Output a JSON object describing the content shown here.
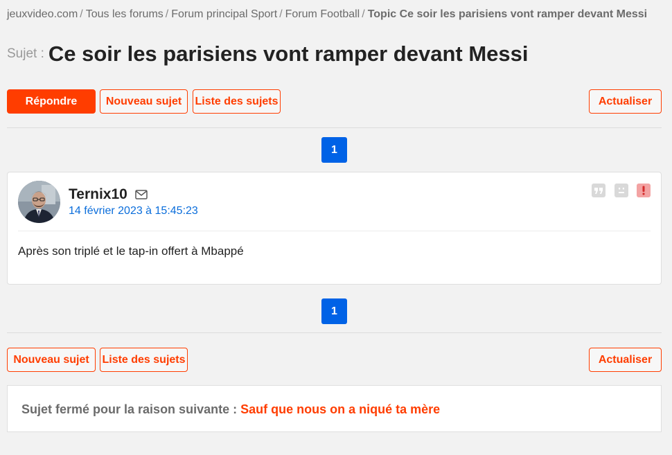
{
  "breadcrumb": {
    "items": [
      "jeuxvideo.com",
      "Tous les forums",
      "Forum principal Sport",
      "Forum Football"
    ],
    "separator": "/",
    "current": "Topic Ce soir les parisiens vont ramper devant Messi"
  },
  "topic": {
    "prefix": "Sujet :",
    "title": "Ce soir les parisiens vont ramper devant Messi"
  },
  "toolbar_top": {
    "reply_label": "Répondre",
    "new_topic_label": "Nouveau sujet",
    "topic_list_label": "Liste des sujets",
    "refresh_label": "Actualiser"
  },
  "pagination": {
    "current_page": "1"
  },
  "post": {
    "author": "Ternix10",
    "date": "14 février 2023 à 15:45:23",
    "body": "Après son triplé et le tap-in offert à Mbappé",
    "icons": [
      "mail-icon",
      "quote-icon",
      "sad-face-icon",
      "report-icon"
    ]
  },
  "toolbar_bottom": {
    "new_topic_label": "Nouveau sujet",
    "topic_list_label": "Liste des sujets",
    "refresh_label": "Actualiser"
  },
  "closed": {
    "label": "Sujet fermé pour la raison suivante :",
    "reason": "Sauf que nous on a niqué ta mère"
  },
  "colors": {
    "accent": "#ff3d00",
    "page_blue": "#0062e6",
    "date_blue": "#0a6ddb",
    "background": "#f2f2f2"
  }
}
